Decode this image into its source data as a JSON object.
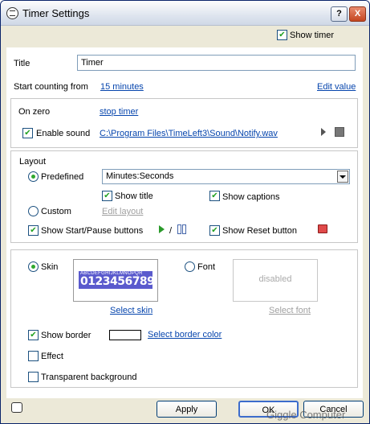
{
  "window": {
    "title": "Timer Settings",
    "help_btn": "?",
    "close_btn": "X"
  },
  "top": {
    "show_timer_label": "Show timer",
    "show_timer_checked": true
  },
  "title_field": {
    "label": "Title",
    "value": "Timer"
  },
  "start": {
    "label": "Start counting from",
    "value_link": "15 minutes",
    "edit_link": "Edit value"
  },
  "on_zero": {
    "label": "On zero",
    "action_link": "stop timer",
    "enable_sound_label": "Enable sound",
    "enable_sound_checked": true,
    "sound_path": "C:\\Program Files\\TimeLeft3\\Sound\\Notify.wav"
  },
  "layout": {
    "group_label": "Layout",
    "predefined_label": "Predefined",
    "predefined_selected": true,
    "format_value": "Minutes:Seconds",
    "show_title_label": "Show title",
    "show_title_checked": true,
    "show_captions_label": "Show captions",
    "show_captions_checked": true,
    "custom_label": "Custom",
    "edit_layout_link": "Edit layout",
    "show_startpause_label": "Show Start/Pause buttons",
    "show_startpause_checked": true,
    "slash": "/",
    "show_reset_label": "Show Reset button",
    "show_reset_checked": true
  },
  "appearance": {
    "skin_label": "Skin",
    "skin_selected": true,
    "skin_preview_letters": "ABCDEFGHIJKLMNOPQR",
    "skin_preview_digits": "0123456789",
    "select_skin_link": "Select skin",
    "font_label": "Font",
    "font_selected": false,
    "font_preview_text": "disabled",
    "select_font_link": "Select font",
    "show_border_label": "Show border",
    "show_border_checked": true,
    "select_border_color_link": "Select border color",
    "border_color": "#ffffff",
    "effect_label": "Effect",
    "effect_checked": false,
    "transparent_label": "Transparent background",
    "transparent_checked": false
  },
  "footer": {
    "apply": "Apply",
    "ok": "OK",
    "cancel": "Cancel",
    "watermark": "Giggle Computer"
  },
  "colors": {
    "link": "#0645ad",
    "skin_bg": "#5a5acd",
    "check": "#21a121"
  }
}
